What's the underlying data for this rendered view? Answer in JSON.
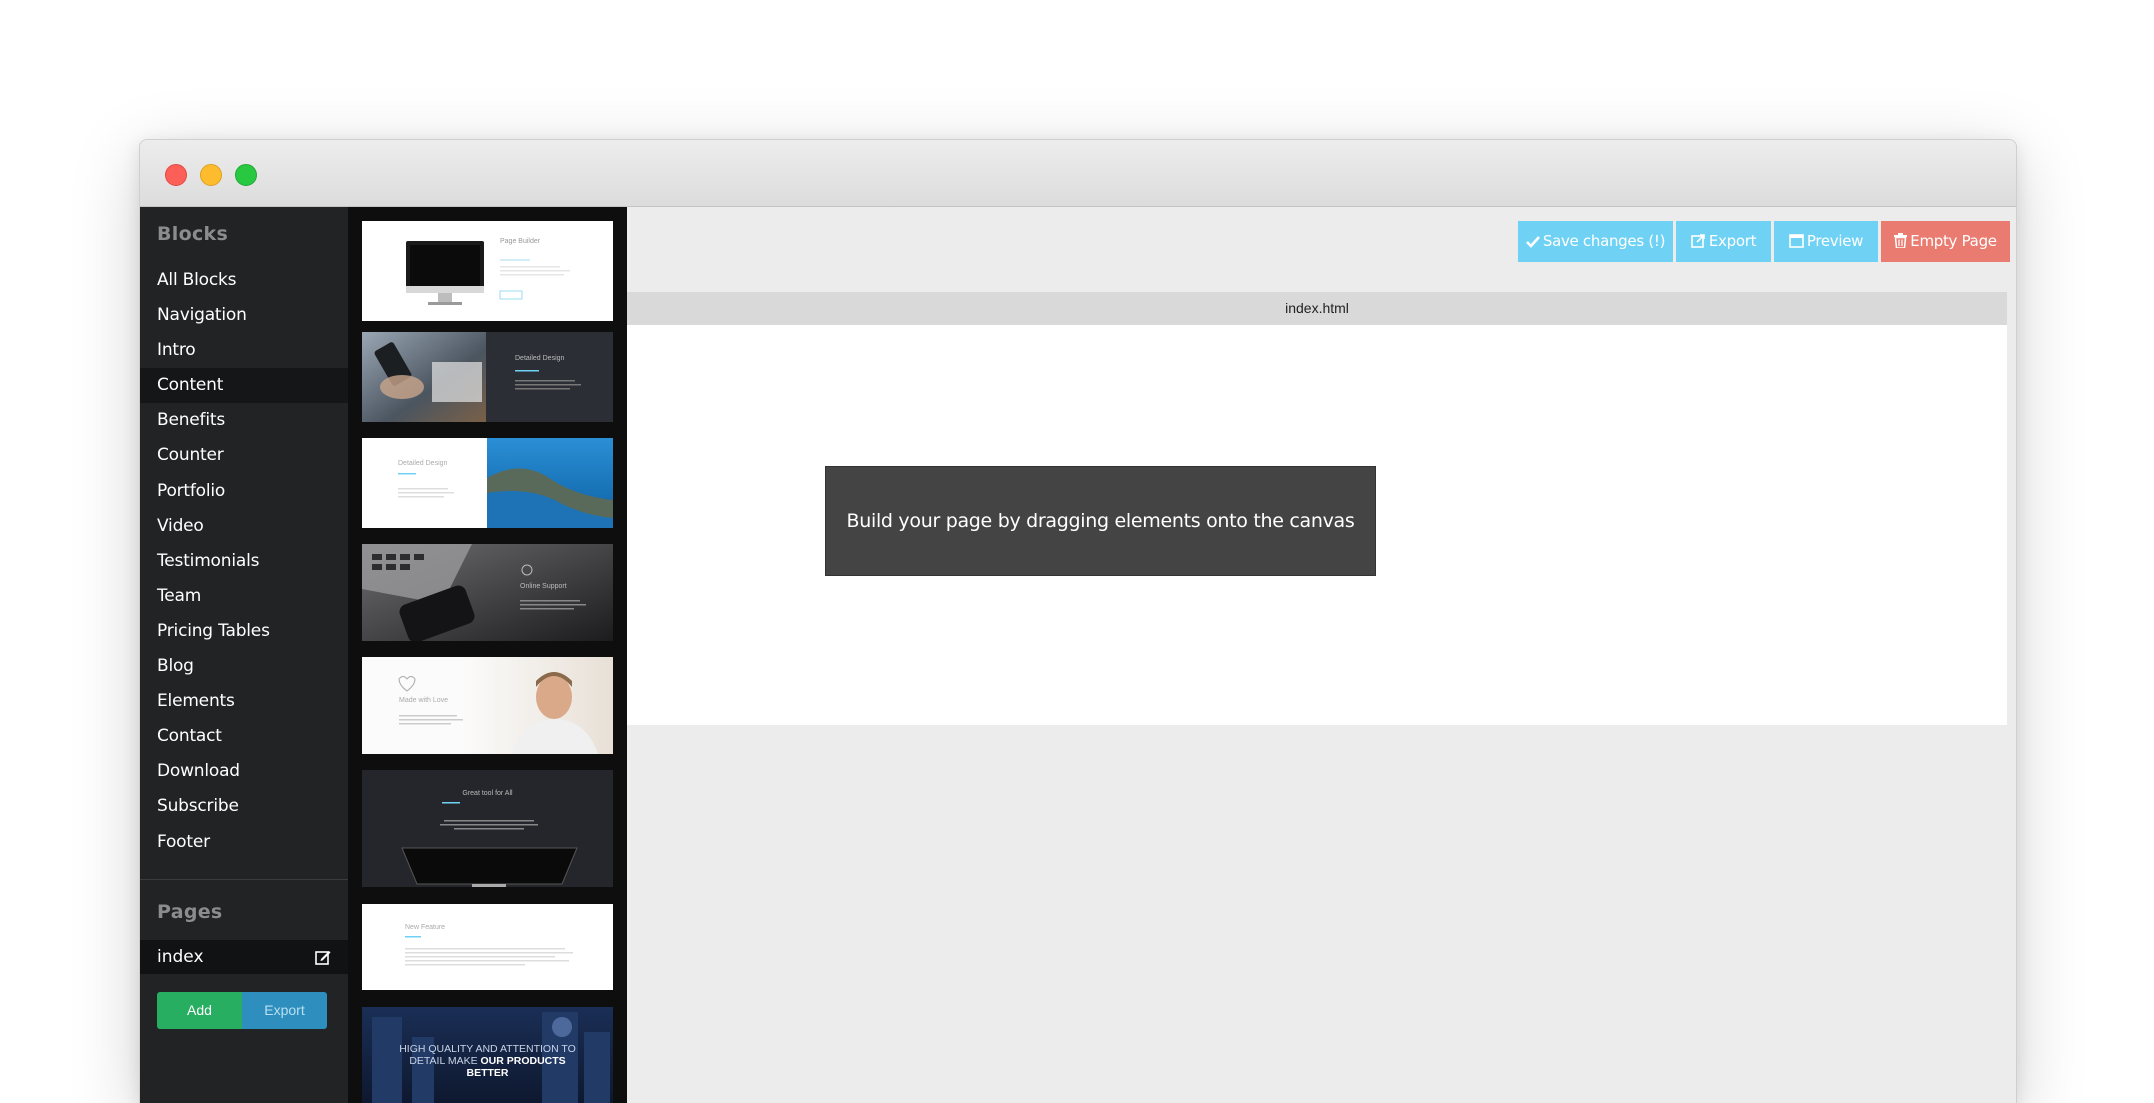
{
  "sidebar": {
    "blocks_heading": "Blocks",
    "items": [
      {
        "label": "All Blocks"
      },
      {
        "label": "Navigation"
      },
      {
        "label": "Intro"
      },
      {
        "label": "Content"
      },
      {
        "label": "Benefits"
      },
      {
        "label": "Counter"
      },
      {
        "label": "Portfolio"
      },
      {
        "label": "Video"
      },
      {
        "label": "Testimonials"
      },
      {
        "label": "Team"
      },
      {
        "label": "Pricing Tables"
      },
      {
        "label": "Blog"
      },
      {
        "label": "Elements"
      },
      {
        "label": "Contact"
      },
      {
        "label": "Download"
      },
      {
        "label": "Subscribe"
      },
      {
        "label": "Footer"
      }
    ],
    "active_item": "Content",
    "pages_heading": "Pages",
    "pages": [
      {
        "label": "index"
      }
    ],
    "add_label": "Add",
    "export_label": "Export"
  },
  "thumbnails": [
    {
      "title": "Page Builder",
      "icon": "monitor-image"
    },
    {
      "title": "Detailed Design",
      "icon": "phone-hands-image"
    },
    {
      "title": "Detailed Design",
      "icon": "coast-image"
    },
    {
      "title": "Online Support",
      "icon": "laptop-image"
    },
    {
      "title": "Made with Love",
      "icon": "man-portrait-image"
    },
    {
      "title": "Great tool for All",
      "icon": "monitor-dark-image"
    },
    {
      "title": "New Feature",
      "icon": "text-block"
    },
    {
      "title_line1": "HIGH QUALITY AND ATTENTION TO",
      "title_line2_normal": "DETAIL MAKE ",
      "title_line2_bold": "OUR PRODUCTS",
      "title_line3": "BETTER",
      "icon": "city-night-image"
    }
  ],
  "toolbar": {
    "save_label": "Save changes (!)",
    "export_label": "Export",
    "preview_label": "Preview",
    "empty_label": "Empty Page"
  },
  "canvas": {
    "tab_label": "index.html",
    "placeholder": "Build your page by dragging elements onto the canvas"
  },
  "colors": {
    "sidebar_bg": "#222324",
    "blocks_bg": "#0e0e0f",
    "toolbar_blue": "#6fd2f4",
    "toolbar_red": "#ea7b70",
    "add_green": "#27ae60",
    "export_blue": "#2e8fbe"
  }
}
